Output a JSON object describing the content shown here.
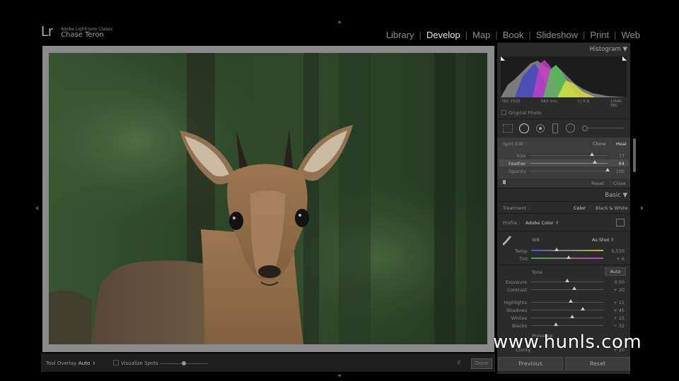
{
  "app": {
    "logo": "Lr",
    "name": "Adobe Lightroom Classic",
    "user": "Chase Teron"
  },
  "modules": [
    {
      "label": "Library",
      "active": false
    },
    {
      "label": "Develop",
      "active": true
    },
    {
      "label": "Map",
      "active": false
    },
    {
      "label": "Book",
      "active": false
    },
    {
      "label": "Slideshow",
      "active": false
    },
    {
      "label": "Print",
      "active": false
    },
    {
      "label": "Web",
      "active": false
    }
  ],
  "histogram": {
    "title": "Histogram",
    "iso": "ISO 2500",
    "focal": "563 mm",
    "aperture": "f / 5.6",
    "shutter": "1/640 SEC",
    "original_photo": "Original Photo"
  },
  "spot_edit": {
    "title": "Spot Edit :",
    "clone": "Clone",
    "heal": "Heal",
    "sliders": [
      {
        "label": "Size",
        "value": "77",
        "fraction": 0.8
      },
      {
        "label": "Feather",
        "value": "84",
        "fraction": 0.84
      },
      {
        "label": "Opacity",
        "value": "100",
        "fraction": 1.0
      }
    ],
    "reset": "Reset",
    "close": "Close"
  },
  "basic": {
    "title": "Basic",
    "treatment_label": "Treatment :",
    "color": "Color",
    "bw": "Black & White",
    "profile_label": "Profile :",
    "profile_value": "Adobe Color",
    "wb_label": "WB :",
    "wb_value": "As Shot",
    "sliders_wb": [
      {
        "label": "Temp",
        "value": "5,550",
        "fraction": 0.35
      },
      {
        "label": "Tint",
        "value": "+ 6",
        "fraction": 0.52
      }
    ],
    "tone_label": "Tone",
    "auto": "Auto",
    "sliders_tone": [
      {
        "label": "Exposure",
        "value": "0.00",
        "fraction": 0.5
      },
      {
        "label": "Contrast",
        "value": "+ 20",
        "fraction": 0.6
      },
      {
        "label": "Highlights",
        "value": "+ 11",
        "fraction": 0.55
      },
      {
        "label": "Shadows",
        "value": "+ 45",
        "fraction": 0.72
      },
      {
        "label": "Whites",
        "value": "+ 15",
        "fraction": 0.57
      },
      {
        "label": "Blacks",
        "value": "− 32",
        "fraction": 0.34
      }
    ],
    "presence_label": "Presence",
    "clarity_label": "Clarity",
    "clarity_value": "+ 10"
  },
  "toolbar": {
    "overlay_label": "Tool Overlay :",
    "overlay_value": "Auto",
    "visualize": "Visualize Spots",
    "done": "Done",
    "visualize_fraction": 0.5
  },
  "buttons": {
    "previous": "Previous",
    "reset": "Reset"
  },
  "watermark": "www.hunls.com"
}
